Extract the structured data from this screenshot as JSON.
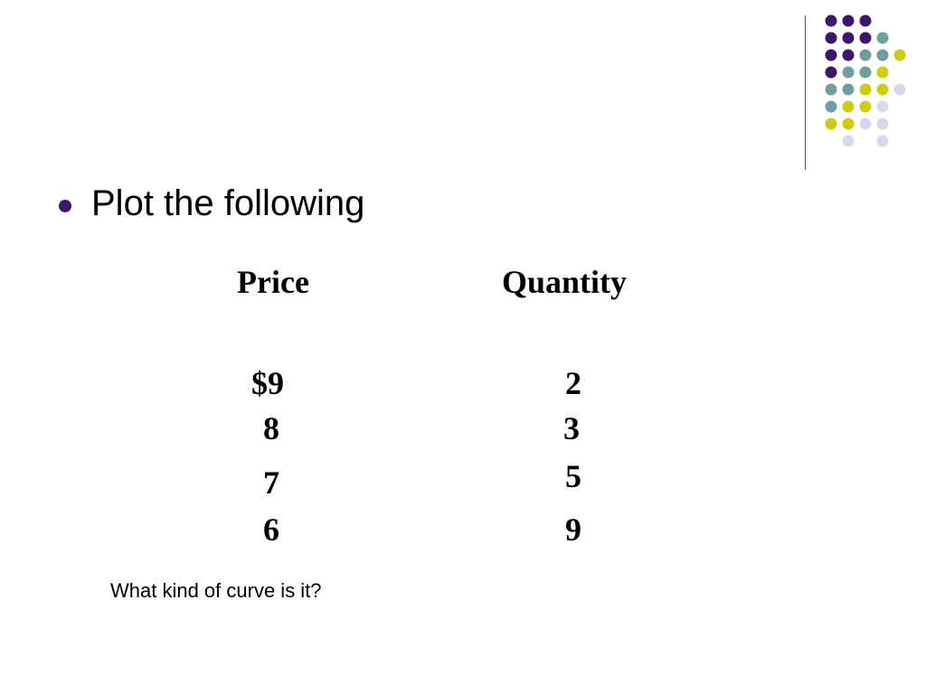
{
  "decor": {
    "colors": {
      "purple": "#3b1669",
      "teal": "#6f9e9e",
      "yellow": "#cfcb10",
      "lavender": "#d8d8ea",
      "divider": "#555555",
      "bullet": "#3b1669"
    },
    "dot_grid": [
      [
        "purple",
        "purple",
        "purple",
        "",
        "",
        ""
      ],
      [
        "purple",
        "purple",
        "purple",
        "teal",
        "",
        ""
      ],
      [
        "purple",
        "purple",
        "teal",
        "teal",
        "yellow",
        ""
      ],
      [
        "purple",
        "teal",
        "teal",
        "yellow",
        "",
        ""
      ],
      [
        "teal",
        "teal",
        "yellow",
        "yellow",
        "lavender",
        ""
      ],
      [
        "teal",
        "yellow",
        "yellow",
        "lavender",
        "",
        ""
      ],
      [
        "yellow",
        "yellow",
        "lavender",
        "lavender",
        "",
        ""
      ],
      [
        "",
        "lavender",
        "",
        "lavender",
        "",
        ""
      ]
    ]
  },
  "slide": {
    "bullet": "Plot the following",
    "table": {
      "headers": {
        "price": "Price",
        "quantity": "Quantity"
      },
      "rows": [
        {
          "price": "$9",
          "quantity": "2"
        },
        {
          "price": "8",
          "quantity": "3"
        },
        {
          "price": "7",
          "quantity": "5"
        },
        {
          "price": "6",
          "quantity": "9"
        }
      ]
    },
    "question": "What kind of curve is it?"
  }
}
